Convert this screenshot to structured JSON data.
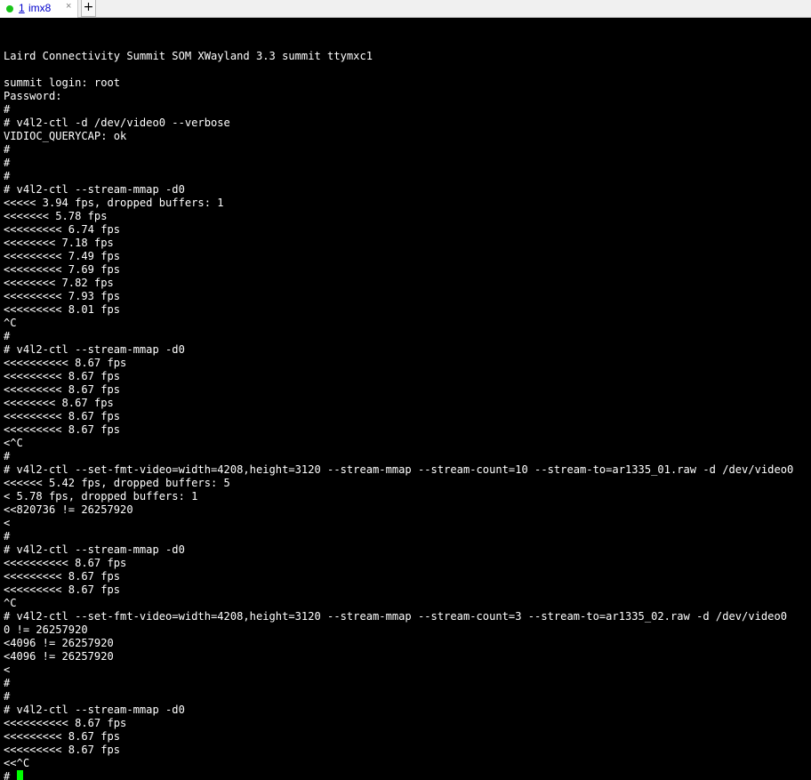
{
  "tab": {
    "number": "1",
    "label": "imx8",
    "close_icon": "×",
    "status_color": "#19c519"
  },
  "new_tab_icon": "+",
  "terminal": {
    "background": "#000000",
    "foreground": "#ffffff",
    "cursor_color": "#00ff00",
    "lines": [
      "",
      "Laird Connectivity Summit SOM XWayland 3.3 summit ttymxc1",
      "",
      "summit login: root",
      "Password:",
      "#",
      "# v4l2-ctl -d /dev/video0 --verbose",
      "VIDIOC_QUERYCAP: ok",
      "#",
      "#",
      "#",
      "# v4l2-ctl --stream-mmap -d0",
      "<<<<< 3.94 fps, dropped buffers: 1",
      "<<<<<<< 5.78 fps",
      "<<<<<<<<< 6.74 fps",
      "<<<<<<<< 7.18 fps",
      "<<<<<<<<< 7.49 fps",
      "<<<<<<<<< 7.69 fps",
      "<<<<<<<< 7.82 fps",
      "<<<<<<<<< 7.93 fps",
      "<<<<<<<<< 8.01 fps",
      "^C",
      "#",
      "# v4l2-ctl --stream-mmap -d0",
      "<<<<<<<<<< 8.67 fps",
      "<<<<<<<<< 8.67 fps",
      "<<<<<<<<< 8.67 fps",
      "<<<<<<<< 8.67 fps",
      "<<<<<<<<< 8.67 fps",
      "<<<<<<<<< 8.67 fps",
      "<^C",
      "#",
      "# v4l2-ctl --set-fmt-video=width=4208,height=3120 --stream-mmap --stream-count=10 --stream-to=ar1335_01.raw -d /dev/video0",
      "<<<<<< 5.42 fps, dropped buffers: 5",
      "< 5.78 fps, dropped buffers: 1",
      "<<820736 != 26257920",
      "<",
      "#",
      "# v4l2-ctl --stream-mmap -d0",
      "<<<<<<<<<< 8.67 fps",
      "<<<<<<<<< 8.67 fps",
      "<<<<<<<<< 8.67 fps",
      "^C",
      "# v4l2-ctl --set-fmt-video=width=4208,height=3120 --stream-mmap --stream-count=3 --stream-to=ar1335_02.raw -d /dev/video0",
      "0 != 26257920",
      "<4096 != 26257920",
      "<4096 != 26257920",
      "<",
      "#",
      "#",
      "# v4l2-ctl --stream-mmap -d0",
      "<<<<<<<<<< 8.67 fps",
      "<<<<<<<<< 8.67 fps",
      "<<<<<<<<< 8.67 fps",
      "<<^C"
    ],
    "prompt": "# "
  }
}
